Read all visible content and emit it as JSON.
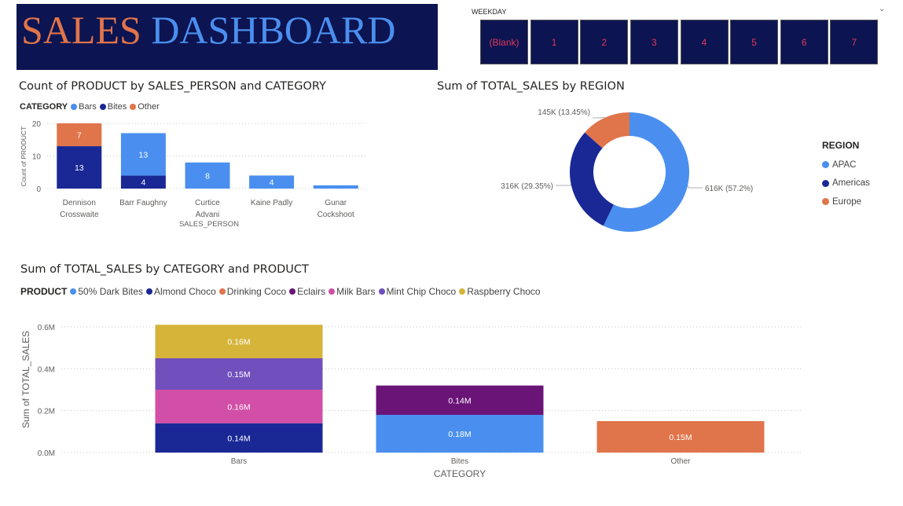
{
  "title": {
    "part1": "SALES",
    "part2": "DASHBOARD"
  },
  "slicer": {
    "label": "WEEKDAY",
    "items": [
      "(Blank)",
      "1",
      "2",
      "3",
      "4",
      "5",
      "6",
      "7"
    ]
  },
  "chart1": {
    "title": "Count of PRODUCT by SALES_PERSON and CATEGORY",
    "legend_title": "CATEGORY",
    "legend": [
      {
        "name": "Bars",
        "color": "#4a8fef"
      },
      {
        "name": "Bites",
        "color": "#1a2896"
      },
      {
        "name": "Other",
        "color": "#e0744a"
      }
    ],
    "ylabel": "Count of PRODUCT",
    "xlabel": "SALES_PERSON",
    "yticks": [
      "0",
      "10",
      "20"
    ]
  },
  "chart2": {
    "title": "Sum of TOTAL_SALES by REGION",
    "legend_title": "REGION",
    "legend": [
      {
        "name": "APAC",
        "color": "#4a8fef"
      },
      {
        "name": "Americas",
        "color": "#1a2896"
      },
      {
        "name": "Europe",
        "color": "#e0744a"
      }
    ],
    "labels": {
      "apac": "616K (57.2%)",
      "americas": "316K (29.35%)",
      "europe": "145K (13.45%)"
    }
  },
  "chart3": {
    "title": "Sum of TOTAL_SALES by CATEGORY and PRODUCT",
    "legend_title": "PRODUCT",
    "legend": [
      {
        "name": "50% Dark Bites",
        "color": "#4a8fef"
      },
      {
        "name": "Almond Choco",
        "color": "#1a2896"
      },
      {
        "name": "Drinking Coco",
        "color": "#e0744a"
      },
      {
        "name": "Eclairs",
        "color": "#6b1478"
      },
      {
        "name": "Milk Bars",
        "color": "#d14fa6"
      },
      {
        "name": "Mint Chip Choco",
        "color": "#7150bd"
      },
      {
        "name": "Raspberry Choco",
        "color": "#d6b43a"
      }
    ],
    "ylabel": "Sum of TOTAL_SALES",
    "xlabel": "CATEGORY",
    "yticks": [
      "0.0M",
      "0.2M",
      "0.4M",
      "0.6M"
    ]
  },
  "chart_data": [
    {
      "type": "bar",
      "title": "Count of PRODUCT by SALES_PERSON and CATEGORY",
      "xlabel": "SALES_PERSON",
      "ylabel": "Count of PRODUCT",
      "categories": [
        "Dennison Crosswaite",
        "Barr Faughny",
        "Curtice Advani",
        "Kaine Padly",
        "Gunar Cockshoot"
      ],
      "series": [
        {
          "name": "Bites",
          "color": "#1a2896",
          "values": [
            13,
            4,
            0,
            0,
            0
          ]
        },
        {
          "name": "Bars",
          "color": "#4a8fef",
          "values": [
            0,
            13,
            8,
            4,
            1
          ]
        },
        {
          "name": "Other",
          "color": "#e0744a",
          "values": [
            7,
            0,
            0,
            0,
            0
          ]
        }
      ],
      "stacked": true,
      "ylim": [
        0,
        20
      ],
      "grid": true,
      "legend_position": "top-left"
    },
    {
      "type": "pie",
      "donut": true,
      "title": "Sum of TOTAL_SALES by REGION",
      "categories": [
        "APAC",
        "Americas",
        "Europe"
      ],
      "values": [
        616000,
        316000,
        145000
      ],
      "percent": [
        57.2,
        29.35,
        13.45
      ],
      "colors": [
        "#4a8fef",
        "#1a2896",
        "#e0744a"
      ],
      "legend_position": "right"
    },
    {
      "type": "bar",
      "title": "Sum of TOTAL_SALES by CATEGORY and PRODUCT",
      "xlabel": "CATEGORY",
      "ylabel": "Sum of TOTAL_SALES",
      "categories": [
        "Bars",
        "Bites",
        "Other"
      ],
      "stacked": true,
      "ylim": [
        0,
        0.6
      ],
      "unit": "M",
      "grid": true,
      "legend_position": "top-left",
      "stacks": [
        [
          {
            "name": "Almond Choco",
            "value": 0.14,
            "label": "0.14M",
            "color": "#1a2896"
          },
          {
            "name": "Milk Bars",
            "value": 0.16,
            "label": "0.16M",
            "color": "#d14fa6"
          },
          {
            "name": "Mint Chip Choco",
            "value": 0.15,
            "label": "0.15M",
            "color": "#7150bd"
          },
          {
            "name": "Raspberry Choco",
            "value": 0.16,
            "label": "0.16M",
            "color": "#d6b43a"
          }
        ],
        [
          {
            "name": "50% Dark Bites",
            "value": 0.18,
            "label": "0.18M",
            "color": "#4a8fef"
          },
          {
            "name": "Eclairs",
            "value": 0.14,
            "label": "0.14M",
            "color": "#6b1478"
          }
        ],
        [
          {
            "name": "Drinking Coco",
            "value": 0.15,
            "label": "0.15M",
            "color": "#e0744a"
          }
        ]
      ]
    }
  ]
}
